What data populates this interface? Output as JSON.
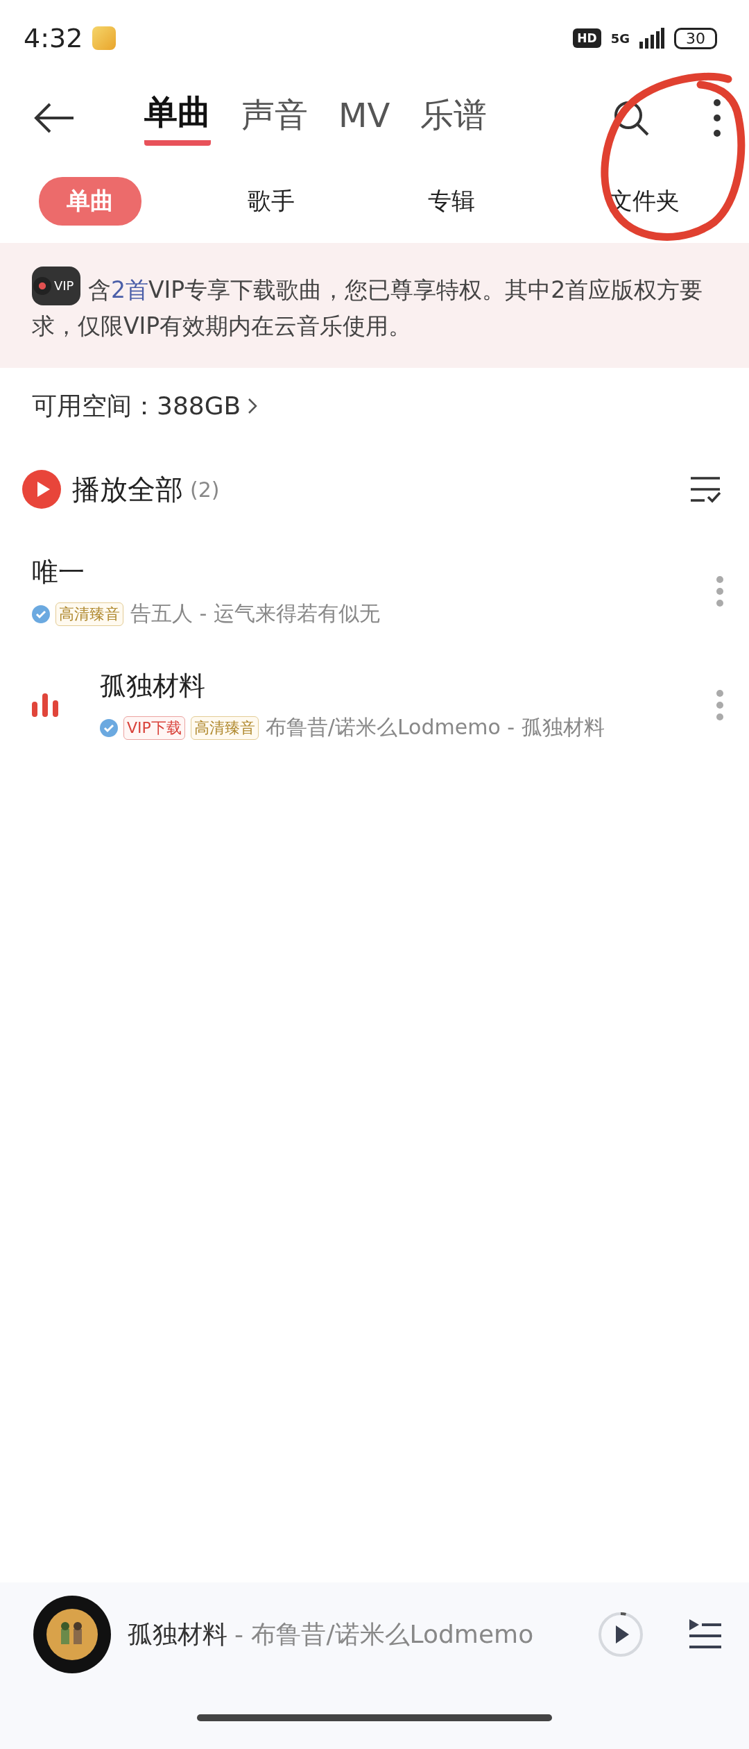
{
  "status_bar": {
    "time": "4:32",
    "hd": "HD",
    "network": "5G",
    "battery": "30"
  },
  "tabs": [
    {
      "label": "单曲",
      "selected": true
    },
    {
      "label": "声音",
      "selected": false
    },
    {
      "label": "MV",
      "selected": false
    },
    {
      "label": "乐谱",
      "selected": false
    }
  ],
  "sub_tabs": [
    {
      "label": "单曲",
      "selected": true
    },
    {
      "label": "歌手",
      "selected": false
    },
    {
      "label": "专辑",
      "selected": false
    },
    {
      "label": "文件夹",
      "selected": false
    }
  ],
  "banner": {
    "badge": "VIP",
    "parts": [
      {
        "text": "含",
        "highlight": false
      },
      {
        "text": "2首",
        "highlight": true
      },
      {
        "text": "VIP专享下载歌曲，您已尊享特权。其中2首应版权方要求，仅限VIP有效期内在云音乐使用。",
        "highlight": false
      }
    ]
  },
  "storage": "可用空间：388GB",
  "play_all": {
    "label": "播放全部",
    "count": "(2)"
  },
  "songs": [
    {
      "title": "唯一",
      "playing": false,
      "tags": [
        {
          "label": "高清臻音",
          "kind": "quality"
        }
      ],
      "subtitle": "告五人 - 运气来得若有似无"
    },
    {
      "title": "孤独材料",
      "playing": true,
      "tags": [
        {
          "label": "VIP下载",
          "kind": "vip"
        },
        {
          "label": "高清臻音",
          "kind": "quality"
        }
      ],
      "subtitle": "布鲁昔/诺米么Lodmemo - 孤独材料"
    }
  ],
  "now_playing": {
    "title": "孤独材料",
    "artist": "- 布鲁昔/诺米么Lodmemo",
    "level": 0.04
  }
}
